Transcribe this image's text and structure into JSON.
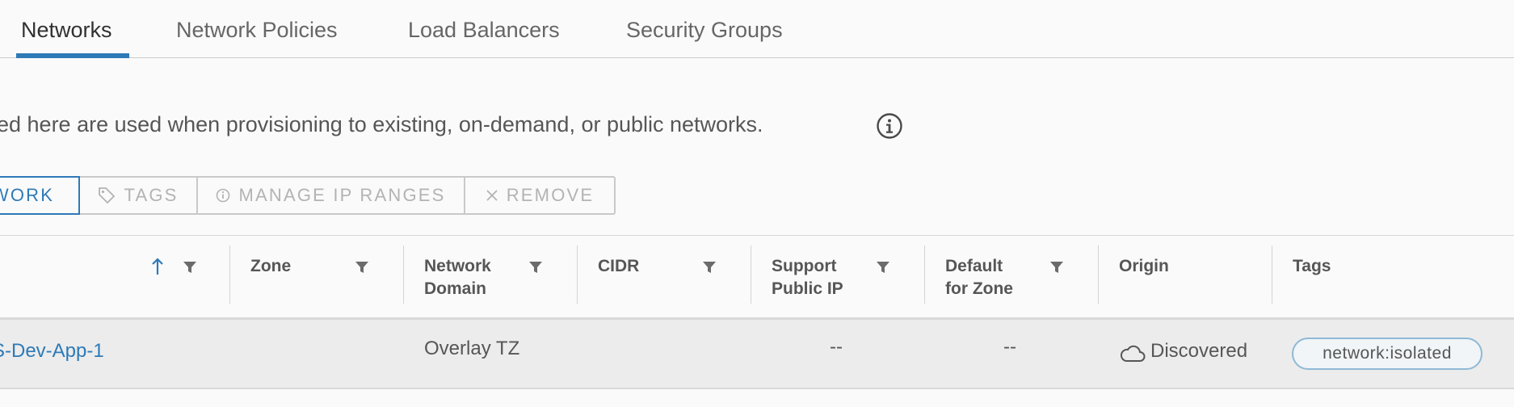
{
  "tabs": [
    {
      "label": "Networks",
      "active": true
    },
    {
      "label": "Network Policies",
      "active": false
    },
    {
      "label": "Load Balancers",
      "active": false
    },
    {
      "label": "Security Groups",
      "active": false
    }
  ],
  "description": "ed here are used when provisioning to existing, on-demand, or public networks.",
  "toolbar": {
    "add_label": "WORK",
    "tags_label": "TAGS",
    "manage_ip_ranges_label": "MANAGE IP RANGES",
    "remove_label": "REMOVE"
  },
  "grid": {
    "columns": {
      "zone": "Zone",
      "network_domain_line1": "Network",
      "network_domain_line2": "Domain",
      "cidr": "CIDR",
      "support_public_ip_line1": "Support",
      "support_public_ip_line2": "Public IP",
      "default_for_zone_line1": "Default",
      "default_for_zone_line2": "for Zone",
      "origin": "Origin",
      "tags": "Tags"
    },
    "rows": [
      {
        "name": "S-Dev-App-1",
        "zone": "",
        "network_domain": "Overlay TZ",
        "cidr": "",
        "support_public_ip": "--",
        "default_for_zone": "--",
        "origin": "Discovered",
        "tag": "network:isolated"
      }
    ]
  },
  "colors": {
    "accent": "#2d7ab8",
    "row_bg": "#ececec",
    "text": "#565656",
    "disabled_text": "#b3b3b3"
  },
  "icons": {
    "info": "info-circle-icon",
    "tag": "tag-icon",
    "manage": "info-circle-icon",
    "remove": "close-icon",
    "sort": "arrow-up-icon",
    "filter": "filter-icon",
    "origin": "cloud-icon"
  }
}
